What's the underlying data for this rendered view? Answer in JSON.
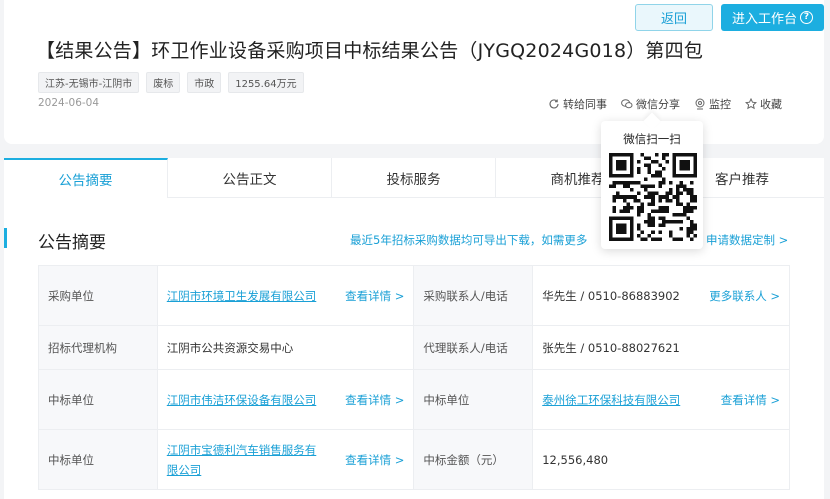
{
  "header": {
    "back_label": "返回",
    "enter_label": "进入工作台",
    "title": "【结果公告】环卫作业设备采购项目中标结果公告（JYGQ2024G018）第四包",
    "tags": [
      "江苏-无锡市-江阴市",
      "废标",
      "市政",
      "1255.64万元"
    ],
    "date": "2024-06-04"
  },
  "actions": {
    "forward": "转给同事",
    "wechat_share": "微信分享",
    "monitor": "监控",
    "favorite": "收藏"
  },
  "qr": {
    "title": "微信扫一扫"
  },
  "tabs": [
    "公告摘要",
    "公告正文",
    "投标服务",
    "商机推荐",
    "客户推荐"
  ],
  "summary": {
    "title": "公告摘要",
    "hint": "最近5年招标采购数据均可导出下载，如需更多",
    "hint_tail": "申请数据定制 >"
  },
  "table": {
    "rows": [
      {
        "label1": "采购单位",
        "value1": "江阴市环境卫生发展有限公司",
        "link1": true,
        "more1": "查看详情 >",
        "label2": "采购联系人/电话",
        "value2": "华先生 / 0510-86883902",
        "link2": false,
        "more2": "更多联系人 >"
      },
      {
        "label1": "招标代理机构",
        "value1": "江阴市公共资源交易中心",
        "link1": false,
        "more1": "",
        "label2": "代理联系人/电话",
        "value2": "张先生 / 0510-88027621",
        "link2": false,
        "more2": ""
      },
      {
        "label1": "中标单位",
        "value1": "江阴市伟洁环保设备有限公司",
        "link1": true,
        "more1": "查看详情 >",
        "label2": "中标单位",
        "value2": "泰州徐工环保科技有限公司",
        "link2": true,
        "more2": "查看详情 >"
      },
      {
        "label1": "中标单位",
        "value1": "江阴市宝德利汽车销售服务有限公司",
        "link1": true,
        "more1": "查看详情 >",
        "label2": "中标金额（元）",
        "value2": "12,556,480",
        "link2": false,
        "more2": ""
      }
    ]
  },
  "colors": {
    "accent": "#1caee0",
    "link": "#1aa0d6"
  }
}
